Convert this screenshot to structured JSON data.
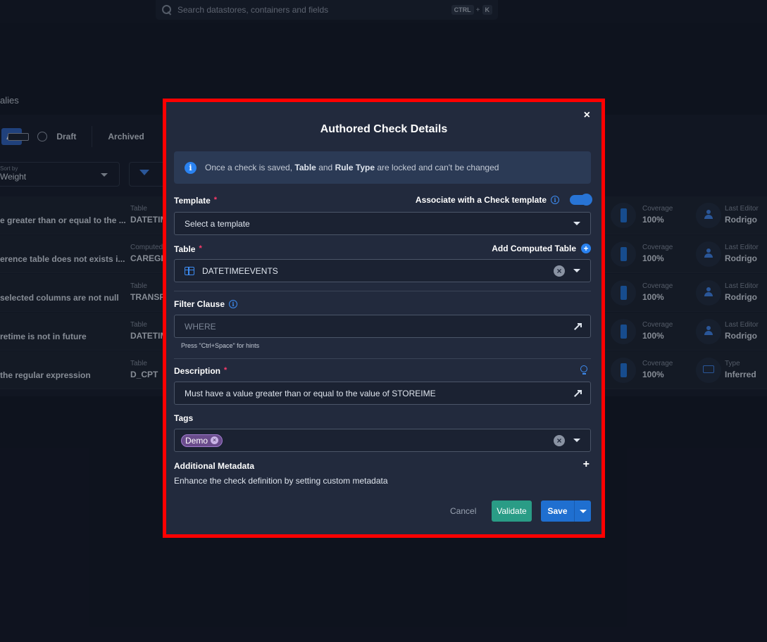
{
  "search": {
    "placeholder": "Search datastores, containers and fields",
    "shortcut_key1": "CTRL",
    "shortcut_plus": "+",
    "shortcut_key2": "K"
  },
  "background": {
    "section_label": "alies",
    "tabs": {
      "all": "All",
      "draft": "Draft",
      "archived": "Archived"
    },
    "sort": {
      "label": "Sort by",
      "value": "Weight"
    },
    "rows": [
      {
        "name": "e greater than or equal to the ...",
        "table_label": "Table",
        "table_value": "DATETIM",
        "cov_label": "Coverage",
        "cov_value": "100%",
        "ed_label": "Last Editor",
        "ed_value": "Rodrigo",
        "ed_icon": "person-icon"
      },
      {
        "name": "erence table does not exists i...",
        "table_label": "Computed",
        "table_value": "CAREGIV",
        "cov_label": "Coverage",
        "cov_value": "100%",
        "ed_label": "Last Editor",
        "ed_value": "Rodrigo",
        "ed_icon": "person-icon"
      },
      {
        "name": "selected columns are not null",
        "table_label": "Table",
        "table_value": "TRANSFI",
        "cov_label": "Coverage",
        "cov_value": "100%",
        "ed_label": "Last Editor",
        "ed_value": "Rodrigo",
        "ed_icon": "person-icon"
      },
      {
        "name": "retime is not in future",
        "table_label": "Table",
        "table_value": "DATETIM",
        "cov_label": "Coverage",
        "cov_value": "100%",
        "ed_label": "Last Editor",
        "ed_value": "Rodrigo",
        "ed_icon": "person-icon"
      },
      {
        "name": "the regular expression",
        "table_label": "Table",
        "table_value": "D_CPT",
        "cov_label": "Coverage",
        "cov_value": "100%",
        "ed_label": "Type",
        "ed_value": "Inferred",
        "ed_icon": "monitor-icon"
      }
    ]
  },
  "modal": {
    "close": "×",
    "title": "Authored Check Details",
    "info_prefix": "Once a check is saved, ",
    "info_bold1": "Table",
    "info_mid": " and ",
    "info_bold2": "Rule Type",
    "info_suffix": " are locked and can't be changed",
    "required_mark": "*",
    "template": {
      "label": "Template",
      "associate_label": "Associate with a Check template",
      "associate_enabled": true,
      "placeholder": "Select a template"
    },
    "table": {
      "label": "Table",
      "add_computed_label": "Add Computed Table",
      "value": "DATETIMEEVENTS"
    },
    "filter": {
      "label": "Filter Clause",
      "placeholder": "WHERE",
      "hint": "Press \"Ctrl+Space\" for hints"
    },
    "description": {
      "label": "Description",
      "value": "Must have a value greater than or equal to the value of STOREIME"
    },
    "tags": {
      "label": "Tags",
      "items": [
        "Demo"
      ]
    },
    "metadata": {
      "label": "Additional Metadata",
      "description": "Enhance the check definition by setting custom metadata"
    },
    "buttons": {
      "cancel": "Cancel",
      "validate": "Validate",
      "save": "Save"
    }
  }
}
